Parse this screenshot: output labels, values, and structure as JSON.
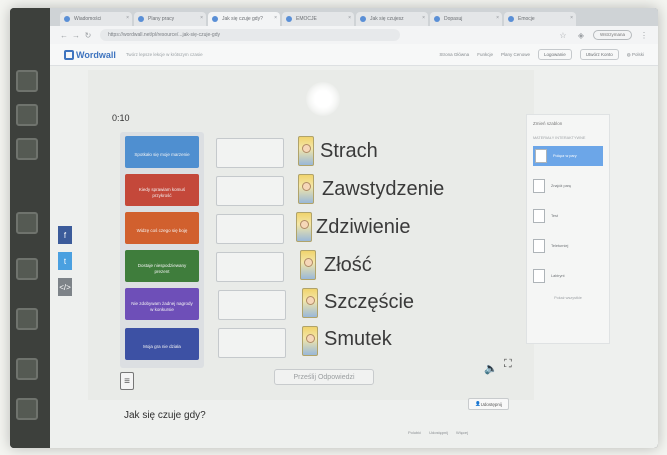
{
  "browser": {
    "tabs": [
      {
        "label": "Wiadomości",
        "active": false
      },
      {
        "label": "Plany pracy",
        "active": false
      },
      {
        "label": "Jak się czuje gdy?",
        "active": true
      },
      {
        "label": "EMOCJE",
        "active": false
      },
      {
        "label": "Jak się czujesz",
        "active": false
      },
      {
        "label": "Dopasuj",
        "active": false
      },
      {
        "label": "Emocje",
        "active": false
      }
    ],
    "url": "https://wordwall.net/pl/resource/...jak-się-czuje-gdy",
    "profile": "Wstrzymana"
  },
  "header": {
    "logo": "Wordwall",
    "tagline": "Twórz lepsze lekcje w krótszym czasie",
    "links": [
      "Strona Główna",
      "Funkcje",
      "Plany Cenowe"
    ],
    "login": "Logowanie",
    "signup": "Utwórz Konto",
    "language": "Polski"
  },
  "game": {
    "timer": "0:10",
    "cards": [
      {
        "text": "Spotkało się moje marzenie",
        "color": "#4f8fd0"
      },
      {
        "text": "Kiedy sprawiam komuś przykrość",
        "color": "#c4483a"
      },
      {
        "text": "Widzę coś czego się boję",
        "color": "#d1602e"
      },
      {
        "text": "Dostaje niespodziewany prezent",
        "color": "#3f7d3c"
      },
      {
        "text": "Nie zdobywam żadnej nagrody w konkursie",
        "color": "#6e4fb8"
      },
      {
        "text": "Moja gra nie działa",
        "color": "#3d51a4"
      }
    ],
    "words": [
      "Strach",
      "Zawstydzenie",
      "Zdziwienie",
      "Złość",
      "Szczęście",
      "Smutek"
    ],
    "submit": "Prześlij Odpowiedzi"
  },
  "share": {
    "facebook": "f",
    "twitter": "t",
    "embed": "</>"
  },
  "side_panel": {
    "title": "Zmień szablon",
    "subtitle": "MATERIAŁY INTERAKTYWNE",
    "templates": [
      {
        "label": "Połącz w pary",
        "active": true
      },
      {
        "label": "Znajdź parę",
        "active": false
      },
      {
        "label": "Test",
        "active": false
      },
      {
        "label": "Teleturniej",
        "active": false
      },
      {
        "label": "Labirynt",
        "active": false
      }
    ],
    "more": "Pokaż wszystkie"
  },
  "below": {
    "share_button": "Udostępnij",
    "title": "Jak się czuje gdy?",
    "footer_links": [
      "Polubić",
      "Udostępnij",
      "Więcej"
    ]
  }
}
